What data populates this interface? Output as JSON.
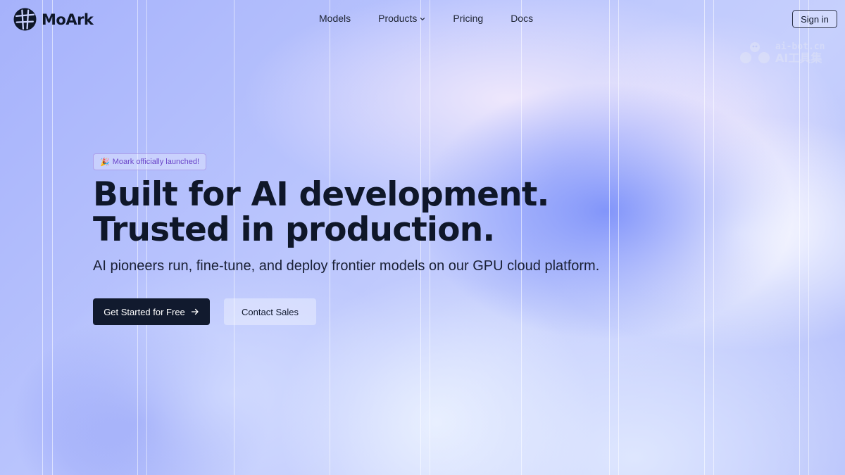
{
  "brand": {
    "name": "MoArk",
    "color": "#0f1729"
  },
  "nav": {
    "items": [
      {
        "label": "Models",
        "has_dropdown": false
      },
      {
        "label": "Products",
        "has_dropdown": true
      },
      {
        "label": "Pricing",
        "has_dropdown": false
      },
      {
        "label": "Docs",
        "has_dropdown": false
      }
    ],
    "signin_label": "Sign in"
  },
  "watermark": {
    "line1": "ai-bot.cn",
    "line2": "AI工具集"
  },
  "hero": {
    "badge_emoji": "🎉",
    "badge_text": "Moark officially launched!",
    "headline_line1": "Built for AI development.",
    "headline_line2": "Trusted in production.",
    "subtitle": "AI pioneers run, fine-tune, and deploy frontier models on our GPU cloud platform.",
    "primary_cta": "Get Started for Free",
    "secondary_cta": "Contact Sales"
  },
  "colors": {
    "accent_dark": "#111a2e",
    "badge_text": "#6a45c9",
    "background_start": "#a6b2fb",
    "background_end": "#c7d0fd"
  },
  "icons": {
    "logo": "globe-grid-icon",
    "dropdown": "chevron-down-icon",
    "cta": "arrow-right-icon",
    "watermark": "robot-mascot-icon"
  }
}
